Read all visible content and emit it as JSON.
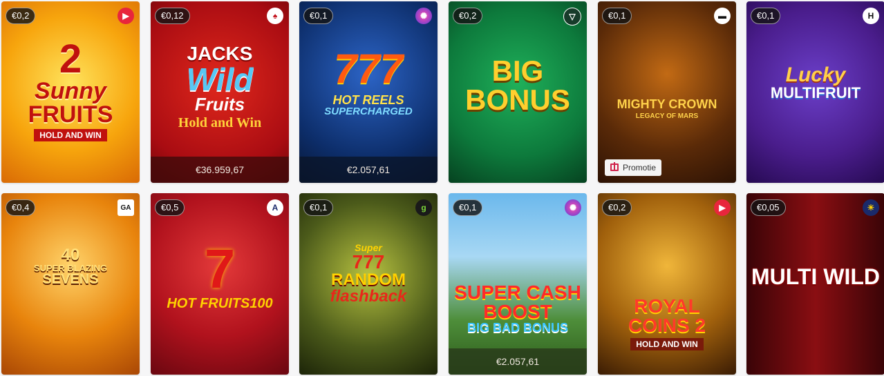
{
  "games": [
    {
      "stake": "€0,2",
      "title_lines": [
        "2",
        "Sunny",
        "FRUITS",
        "HOLD AND WIN"
      ],
      "provider_icon": "play-triangle-icon",
      "bg": "#f6a10f"
    },
    {
      "stake": "€0,12",
      "title_lines": [
        "JACKS",
        "Wild",
        "Fruits",
        "Hold and Win"
      ],
      "provider_icon": "spade-icon",
      "jackpot": "€36.959,67",
      "bg": "#c21016"
    },
    {
      "stake": "€0,1",
      "title_lines": [
        "777",
        "HOT REELS",
        "SUPERCHARGED"
      ],
      "provider_icon": "firework-icon",
      "jackpot": "€2.057,61",
      "bg": "#0d2e6b"
    },
    {
      "stake": "€0,2",
      "title_lines": [
        "BIG",
        "BONUS"
      ],
      "provider_icon": "v-shield-icon",
      "bg": "#0d7a3c"
    },
    {
      "stake": "€0,1",
      "title_lines": [
        "MIGHTY CROWN",
        "LEGACY OF MARS"
      ],
      "provider_icon": "sunglasses-icon",
      "promotion": "Promotie",
      "bg": "#5a2a08"
    },
    {
      "stake": "€0,1",
      "title_lines": [
        "Lucky",
        "MULTIFRUIT"
      ],
      "provider_icon": "h-icon",
      "bg": "#4a1d8c"
    },
    {
      "stake": "€0,4",
      "title_lines": [
        "40",
        "SUPER BLAZING",
        "SEVENS"
      ],
      "provider_icon": "ga-icon",
      "bg": "#d9780c"
    },
    {
      "stake": "€0,5",
      "title_lines": [
        "7",
        "HOT FRUITS100"
      ],
      "provider_icon": "a-icon",
      "bg": "#b1121d"
    },
    {
      "stake": "€0,1",
      "title_lines": [
        "Super",
        "777",
        "RANDOM",
        "flashback"
      ],
      "provider_icon": "g-icon",
      "bg": "#4b5a1a"
    },
    {
      "stake": "€0,1",
      "title_lines": [
        "SUPER CASH",
        "BOOST",
        "BIG BAD BONUS"
      ],
      "provider_icon": "firework-icon",
      "jackpot": "€2.057,61",
      "bg": "#4d9fd8"
    },
    {
      "stake": "€0,2",
      "title_lines": [
        "ROYAL",
        "COINS 2",
        "HOLD AND WIN"
      ],
      "provider_icon": "play-triangle-icon",
      "bg": "#7a3f06"
    },
    {
      "stake": "€0,05",
      "title_lines": [
        "MULTI WILD"
      ],
      "provider_icon": "sun-icon",
      "bg": "#5a0a0c"
    }
  ]
}
